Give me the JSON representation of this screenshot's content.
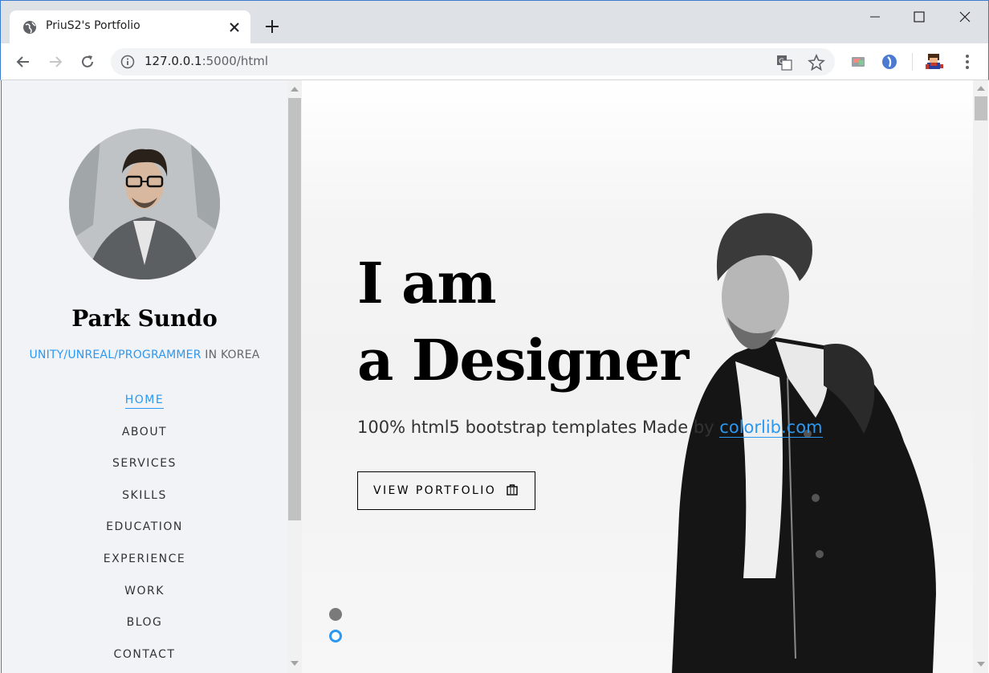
{
  "browser": {
    "tab_title": "PriuS2's Portfolio",
    "url_host": "127.0.0.1",
    "url_rest": ":5000/html"
  },
  "sidebar": {
    "name": "Park Sundo",
    "role_highlight": "UNITY/UNREAL/PROGRAMMER",
    "role_rest": " IN KOREA",
    "nav": [
      {
        "label": "HOME",
        "active": true
      },
      {
        "label": "ABOUT"
      },
      {
        "label": "SERVICES"
      },
      {
        "label": "SKILLS"
      },
      {
        "label": "EDUCATION"
      },
      {
        "label": "EXPERIENCE"
      },
      {
        "label": "WORK"
      },
      {
        "label": "BLOG"
      },
      {
        "label": "CONTACT"
      }
    ]
  },
  "hero": {
    "line1": "I am",
    "line2": "a Designer",
    "subtitle_prefix": "100% html5 bootstrap templates Made by ",
    "subtitle_link": "colorlib.com",
    "button_label": "VIEW PORTFOLIO"
  },
  "colors": {
    "accent": "#2c98f0",
    "sidebar_bg": "#f2f3f7",
    "text_dark": "#000000"
  },
  "icons": [
    "globe-icon",
    "close-icon",
    "plus-icon",
    "back-icon",
    "forward-icon",
    "reload-icon",
    "info-icon",
    "translate-icon",
    "star-icon",
    "menu-icon",
    "bag-icon"
  ]
}
